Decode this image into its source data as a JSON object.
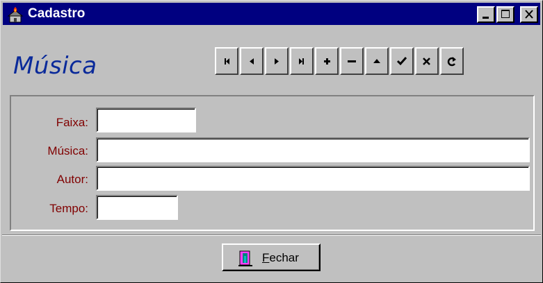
{
  "window": {
    "title": "Cadastro",
    "app_icon": "house-fire-icon"
  },
  "title_buttons": {
    "minimize": "minimize-icon",
    "maximize": "maximize-icon",
    "close": "close-icon"
  },
  "header": {
    "title": "Música"
  },
  "navigator": {
    "buttons": [
      "first",
      "prior",
      "next",
      "last",
      "insert",
      "delete",
      "edit",
      "post",
      "cancel",
      "refresh"
    ]
  },
  "form": {
    "fields": [
      {
        "label": "Faixa:",
        "value": ""
      },
      {
        "label": "Música:",
        "value": ""
      },
      {
        "label": "Autor:",
        "value": ""
      },
      {
        "label": "Tempo:",
        "value": ""
      }
    ]
  },
  "footer": {
    "close_button": {
      "mnemonic": "F",
      "rest": "echar",
      "icon": "door-icon"
    }
  },
  "colors": {
    "titlebar": "#000080",
    "label": "#800000",
    "header": "#0a2a9a",
    "face": "#c0c0c0"
  }
}
